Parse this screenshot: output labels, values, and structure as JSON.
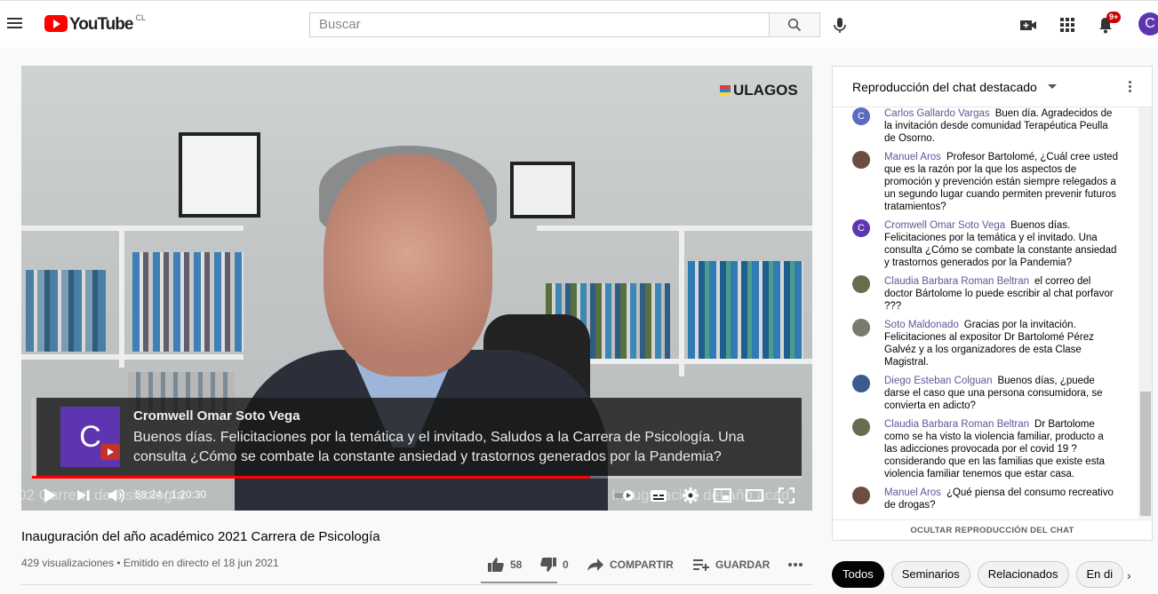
{
  "header": {
    "logo_text": "YouTube",
    "country_code": "CL",
    "search_placeholder": "Buscar",
    "notification_count": "9+",
    "avatar_letter": "C"
  },
  "player": {
    "watermark": "ULAGOS",
    "highlight": {
      "avatar_letter": "C",
      "author": "Cromwell Omar Soto Vega",
      "message": "Buenos días. Felicitaciones por la temática y el invitado, Saludos a la Carrera de Psicología. Una consulta ¿Cómo se combate la constante ansiedad y trastornos generados por la Pandemia?"
    },
    "ticker_left": "02  Carrera de Psicología",
    "ticker_right": "Inauguración del año acad",
    "time": "58:24 / 1:20:30",
    "progress_fraction": 0.725
  },
  "video": {
    "title": "Inauguración del año académico 2021 Carrera de Psicología",
    "meta": "429 visualizaciones • Emitido en directo el 18 jun 2021",
    "likes": "58",
    "dislikes": "0",
    "share_label": "COMPARTIR",
    "save_label": "GUARDAR"
  },
  "chat": {
    "title": "Reproducción del chat destacado",
    "hide_label": "OCULTAR REPRODUCCIÓN DEL CHAT",
    "messages": [
      {
        "author": "Carlos Gallardo Vargas",
        "text": "Buen día. Agradecidos de la invitación desde comunidad Terapéutica Peulla de Osorno.",
        "avatar": "C",
        "color": "#5c6bc0"
      },
      {
        "author": "Manuel Aros",
        "text": "Profesor Bartolomé, ¿Cuál cree usted que es la razón por la que los aspectos de promoción y prevención están siempre relegados a un segundo lugar cuando permiten prevenir futuros tratamientos?",
        "avatar": "",
        "color": "#6d4c41"
      },
      {
        "author": "Cromwell Omar Soto Vega",
        "text": "Buenos días. Felicitaciones por la temática y el invitado. Una consulta ¿Cómo se combate la constante ansiedad y trastornos generados por la Pandemia?",
        "avatar": "C",
        "color": "#5e35b1"
      },
      {
        "author": "Claudia Barbara Roman Beltran",
        "text": "el correo del doctor Bártolome lo puede escribir al chat porfavor ???",
        "avatar": "",
        "color": "#6b6b4f"
      },
      {
        "author": "Soto Maldonado",
        "text": "Gracias por la invitación. Felicitaciones al expositor Dr Bartolomé Pérez Galvéz y a los organizadores de esta Clase Magistral.",
        "avatar": "",
        "color": "#7a7a6e"
      },
      {
        "author": "Diego Esteban Colguan",
        "text": "Buenos días, ¿puede darse el caso que una persona consumidora, se convierta en adicto?",
        "avatar": "",
        "color": "#3b5b8f"
      },
      {
        "author": "Claudia Barbara Roman Beltran",
        "text": "Dr Bartolome como se ha visto la violencia familiar, producto a las adicciones provocada por el covid 19 ? considerando que en las familias que existe esta violencia familiar tenemos que estar casa.",
        "avatar": "",
        "color": "#6b6b4f"
      },
      {
        "author": "Manuel Aros",
        "text": "¿Qué piensa del consumo recreativo de drogas?",
        "avatar": "",
        "color": "#6d4c41"
      }
    ]
  },
  "chips": [
    "Todos",
    "Seminarios",
    "Relacionados",
    "En di"
  ]
}
